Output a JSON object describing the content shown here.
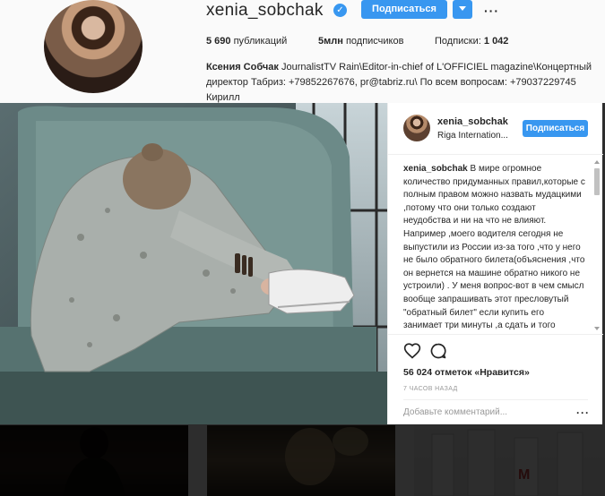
{
  "profile": {
    "username": "xenia_sobchak",
    "follow_label": "Подписаться",
    "stats": {
      "posts_value": "5 690",
      "posts_label": "публикаций",
      "followers_value": "5млн",
      "followers_label": "подписчиков",
      "following_label": "Подписки:",
      "following_value": "1 042"
    },
    "bio_name": "Ксения Собчак",
    "bio_text": "JournalistTV Rain\\Editor-in-chief of L'OFFICIEL magazine\\Концертный директор Табриз: +79852267676, pr@tabriz.ru\\ По всем вопросам: +79037229745 Кирилл"
  },
  "post": {
    "username": "xenia_sobchak",
    "location": "Riga Internation...",
    "follow_label": "Подписаться",
    "caption_user": "xenia_sobchak",
    "caption_text": "В мире огромное количество придуманных правил,которые с полным правом можно назвать мудацкими ,потому что они только создают неудобства и ни на что не влияют. Например ,моего водителя сегодня не выпустили из России из-за того ,что у него не было обратного билета(объяснения ,что он вернется на машине обратно никого не устроили) . У меня вопрос-вот в чем смысл вообще запрашивать этот пресловутый \"обратный билет\" если купить его занимает три минуты ,а сдать и того меньше? Покупаешь-показываешь-",
    "likes_text": "56 024 отметок «Нравится»",
    "timestamp": "7 ЧАСОВ НАЗАД",
    "comment_placeholder": "Добавьте комментарий...",
    "more_symbol": "···"
  },
  "icons": {
    "verified": "verified-badge-icon",
    "like": "heart-icon",
    "comment": "comment-bubble-icon",
    "more": "more-options-icon",
    "dropdown": "chevron-down-icon"
  },
  "colors": {
    "accent": "#3897f0",
    "text": "#262626",
    "muted": "#999999",
    "border": "#efefef"
  }
}
